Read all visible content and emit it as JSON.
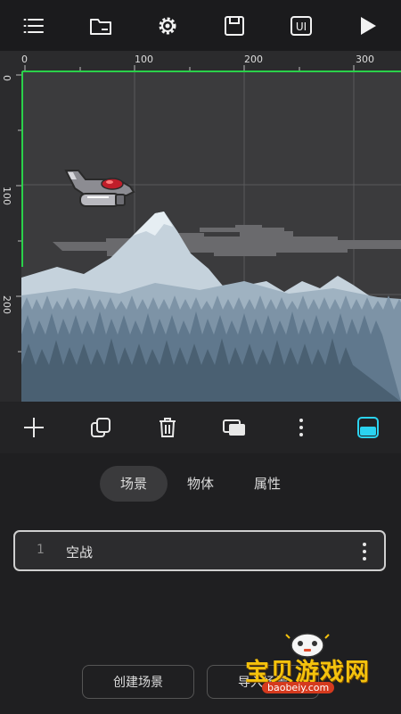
{
  "toolbar_top": {
    "icons": [
      "menu-icon",
      "folder-icon",
      "gear-icon",
      "save-icon",
      "ui-icon",
      "play-icon"
    ],
    "ui_label": "UI"
  },
  "ruler": {
    "x_labels": [
      "0",
      "100",
      "200",
      "300"
    ],
    "y_labels": [
      "0",
      "100",
      "200"
    ]
  },
  "edit_toolbar": {
    "icons": [
      "add-icon",
      "duplicate-icon",
      "delete-icon",
      "layers-icon",
      "more-icon",
      "panel-toggle-icon"
    ]
  },
  "tabs": [
    {
      "label": "场景",
      "active": true
    },
    {
      "label": "物体",
      "active": false
    },
    {
      "label": "属性",
      "active": false
    }
  ],
  "scenes": [
    {
      "index": "1",
      "name": "空战"
    }
  ],
  "actions": {
    "create_scene": "创建场景",
    "import_scene": "导入场景"
  },
  "watermark": {
    "title": "宝贝游戏网",
    "url": "baobeiy.com"
  },
  "colors": {
    "accent": "#2bd3f0",
    "guide": "#2ad14a"
  }
}
